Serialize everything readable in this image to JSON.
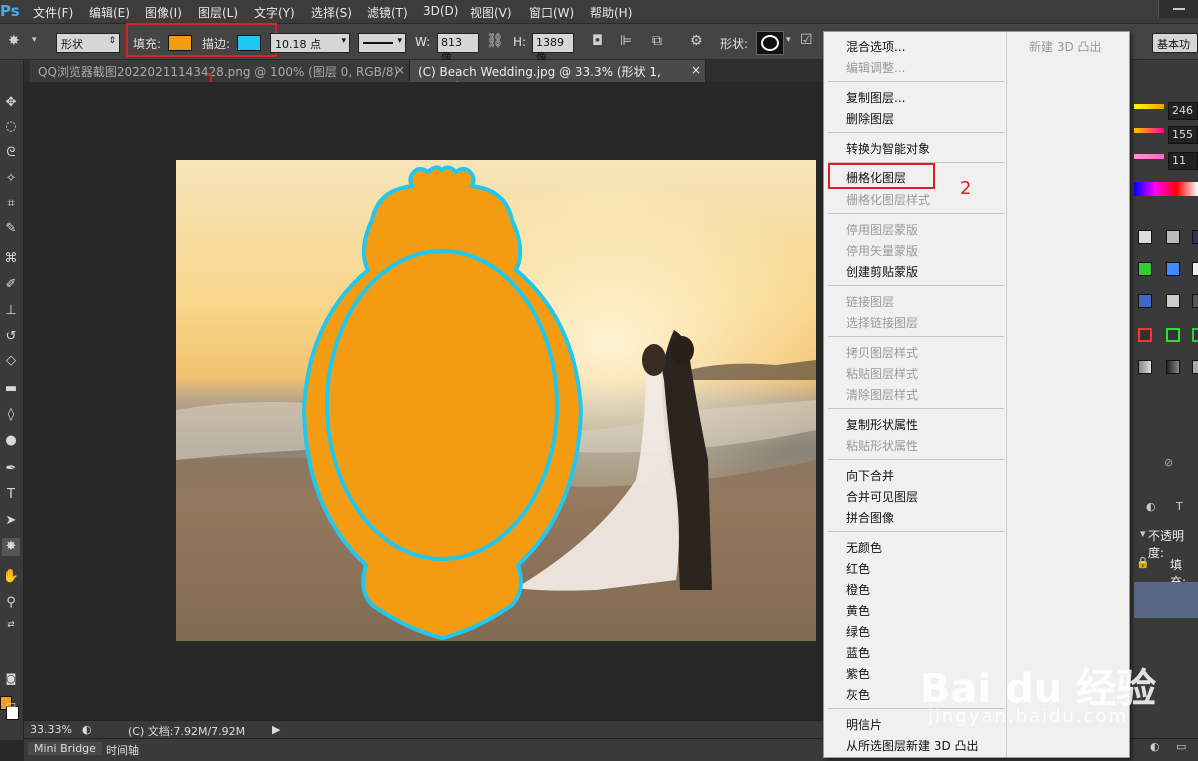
{
  "menubar": {
    "logo": "Ps",
    "items": [
      "文件(F)",
      "编辑(E)",
      "图像(I)",
      "图层(L)",
      "文字(Y)",
      "选择(S)",
      "滤镜(T)",
      "3D(D)",
      "视图(V)",
      "窗口(W)",
      "帮助(H)"
    ]
  },
  "options": {
    "mode": "形状",
    "fill_label": "填充:",
    "fill_color": "#f39c12",
    "stroke_label": "描边:",
    "stroke_color": "#1ec8f0",
    "stroke_width": "10.18 点",
    "w_label": "W:",
    "w_value": "813 像",
    "h_label": "H:",
    "h_value": "1389 像",
    "shape_label": "形状:",
    "workspace": "基本功"
  },
  "annotations": {
    "one": "1",
    "two": "2"
  },
  "tabs": [
    {
      "label": "QQ浏览器截图20220211143428.png @ 100% (图层 0, RGB/8) *",
      "active": false
    },
    {
      "label": "(C) Beach Wedding.jpg @ 33.3% (形状 1, RGB/8) *",
      "active": true
    }
  ],
  "status": {
    "zoom": "33.33%",
    "doc": "(C) 文档:7.92M/7.92M"
  },
  "bottom_tabs": [
    "Mini Bridge",
    "时间轴"
  ],
  "context_menu": {
    "right_column": [
      "新建 3D 凸出"
    ],
    "items": [
      {
        "label": "混合选项...",
        "enabled": true
      },
      {
        "label": "编辑调整...",
        "enabled": false
      },
      {
        "label": "复制图层...",
        "enabled": true
      },
      {
        "label": "删除图层",
        "enabled": true
      },
      {
        "label": "转换为智能对象",
        "enabled": true
      },
      {
        "label": "栅格化图层",
        "enabled": true
      },
      {
        "label": "栅格化图层样式",
        "enabled": false
      },
      {
        "label": "停用图层蒙版",
        "enabled": false
      },
      {
        "label": "停用矢量蒙版",
        "enabled": false
      },
      {
        "label": "创建剪贴蒙版",
        "enabled": true
      },
      {
        "label": "链接图层",
        "enabled": false
      },
      {
        "label": "选择链接图层",
        "enabled": false
      },
      {
        "label": "拷贝图层样式",
        "enabled": false
      },
      {
        "label": "粘贴图层样式",
        "enabled": false
      },
      {
        "label": "清除图层样式",
        "enabled": false
      },
      {
        "label": "复制形状属性",
        "enabled": true
      },
      {
        "label": "粘贴形状属性",
        "enabled": false
      },
      {
        "label": "向下合并",
        "enabled": true
      },
      {
        "label": "合并可见图层",
        "enabled": true
      },
      {
        "label": "拼合图像",
        "enabled": true
      },
      {
        "label": "无颜色",
        "enabled": true
      },
      {
        "label": "红色",
        "enabled": true
      },
      {
        "label": "橙色",
        "enabled": true
      },
      {
        "label": "黄色",
        "enabled": true
      },
      {
        "label": "绿色",
        "enabled": true
      },
      {
        "label": "蓝色",
        "enabled": true
      },
      {
        "label": "紫色",
        "enabled": true
      },
      {
        "label": "灰色",
        "enabled": true
      },
      {
        "label": "明信片",
        "enabled": true
      },
      {
        "label": "从所选图层新建 3D 凸出",
        "enabled": true
      }
    ]
  },
  "panels": {
    "slider_values": [
      "246",
      "155",
      "11"
    ],
    "opacity_label": "不透明度:",
    "fill_label": "填充:"
  },
  "watermark": {
    "brand": "Bai du 经验",
    "url": "jingyan.baidu.com"
  }
}
